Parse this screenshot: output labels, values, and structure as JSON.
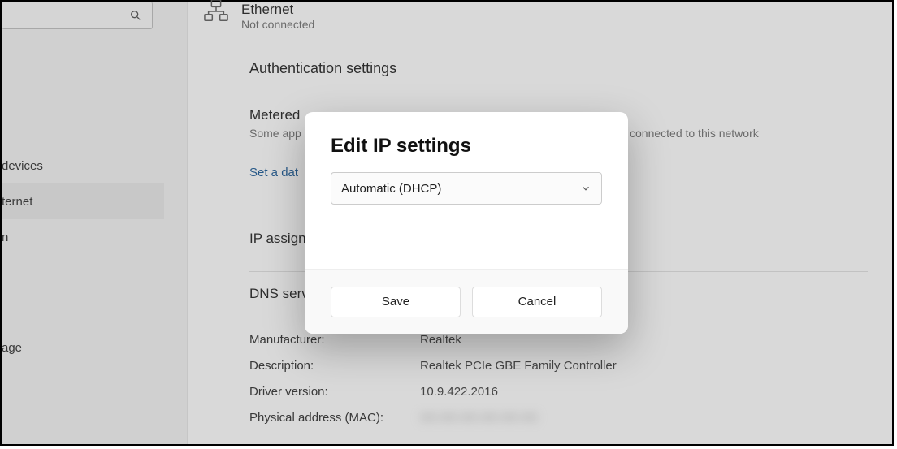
{
  "sidebar": {
    "items": [
      {
        "label": "devices"
      },
      {
        "label": "ternet"
      },
      {
        "label": "n"
      },
      {
        "label": "age"
      }
    ],
    "selected_index": 1
  },
  "main": {
    "ethernet": {
      "title": "Ethernet",
      "status": "Not connected"
    },
    "auth_heading": "Authentication settings",
    "metered": {
      "label": "Metered",
      "sub_left": "Some app",
      "sub_right": "connected to this network"
    },
    "data_link": "Set a dat",
    "ip_assign_label": "IP assign",
    "dns_label": "DNS serv",
    "info": [
      {
        "key": "Manufacturer:",
        "val": "Realtek"
      },
      {
        "key": "Description:",
        "val": "Realtek PCIe GBE Family Controller"
      },
      {
        "key": "Driver version:",
        "val": "10.9.422.2016"
      },
      {
        "key": "Physical address (MAC):",
        "val": "XX-XX-XX-XX-XX-XX",
        "blurred": true
      }
    ]
  },
  "modal": {
    "title": "Edit IP settings",
    "dropdown_value": "Automatic (DHCP)",
    "save_label": "Save",
    "cancel_label": "Cancel"
  }
}
